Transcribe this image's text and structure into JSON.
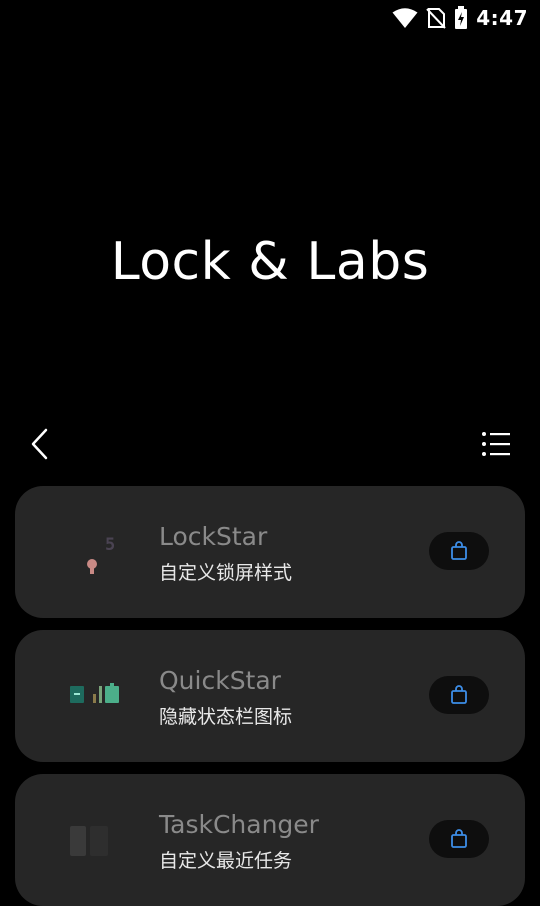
{
  "status_bar": {
    "time": "4:47",
    "icons": [
      "wifi-icon",
      "no-sim-icon",
      "battery-charging-icon"
    ]
  },
  "header": {
    "title": "Lock & Labs"
  },
  "nav": {
    "back_icon": "chevron-left-icon",
    "menu_icon": "list-menu-icon"
  },
  "apps": [
    {
      "name": "LockStar",
      "description": "自定义锁屏样式",
      "icon": "lockstar-app-icon",
      "action_icon": "shopping-bag-icon"
    },
    {
      "name": "QuickStar",
      "description": "隐藏状态栏图标",
      "icon": "quickstar-app-icon",
      "action_icon": "shopping-bag-icon"
    },
    {
      "name": "TaskChanger",
      "description": "自定义最近任务",
      "icon": "taskchanger-app-icon",
      "action_icon": "shopping-bag-icon"
    }
  ],
  "colors": {
    "background": "#000000",
    "card": "#262626",
    "accent": "#3d8ee8"
  }
}
